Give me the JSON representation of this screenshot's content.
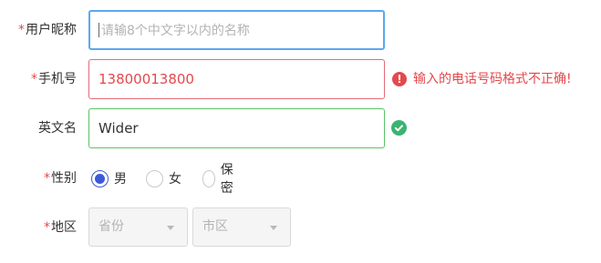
{
  "form": {
    "nickname": {
      "label": "用户昵称",
      "required": "*",
      "placeholder": "请输8个中文字以内的名称",
      "value": ""
    },
    "phone": {
      "label": "手机号",
      "required": "*",
      "value": "13800013800",
      "error_icon": "!",
      "error": "输入的电话号码格式不正确!"
    },
    "english_name": {
      "label": "英文名",
      "required": "",
      "value": "Wider",
      "status_icon": "check-circle-icon"
    },
    "gender": {
      "label": "性别",
      "required": "*",
      "options": [
        "男",
        "女",
        "保密"
      ],
      "selected": "男"
    },
    "region": {
      "label": "地区",
      "required": "*",
      "province_placeholder": "省份",
      "city_placeholder": "市区"
    }
  },
  "colors": {
    "required": "#e5484d",
    "focus_border": "#5aa9ee",
    "error": "#e5484d",
    "success": "#3cb371",
    "radio_checked": "#3b5bd6"
  }
}
